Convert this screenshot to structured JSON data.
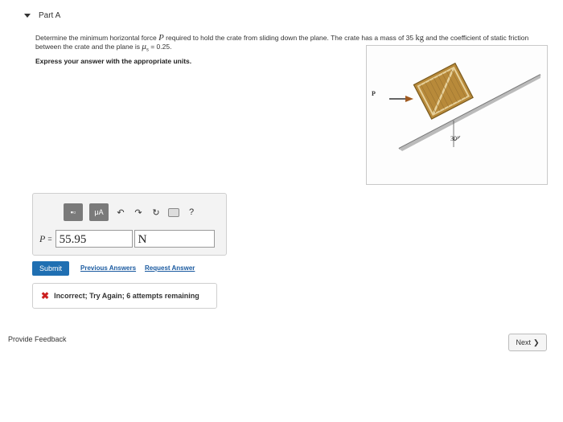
{
  "part": {
    "title": "Part A"
  },
  "problem": {
    "text_a": "Determine the minimum horizontal force ",
    "force_var": "P",
    "text_b": " required to hold the crate from sliding down the plane. The crate has a mass of 35 ",
    "mass_unit": "kg",
    "text_c": " and the coefficient of static friction between the crate and the plane is ",
    "mu": "μ",
    "mu_sub": "s",
    "text_d": " = 0.25.",
    "instruction": "Express your answer with the appropriate units."
  },
  "figure": {
    "force_label": "P",
    "angle_label": "30°"
  },
  "toolbar": {
    "templates_label": "▪▫",
    "units_label": "μA",
    "undo_symbol": "↶",
    "redo_symbol": "↷",
    "reset_symbol": "↻",
    "help_symbol": "?"
  },
  "answer": {
    "label": "P",
    "eq": "=",
    "value": "55.95",
    "unit": "N"
  },
  "actions": {
    "submit": "Submit",
    "previous": "Previous Answers",
    "request": "Request Answer"
  },
  "feedback": {
    "icon": "✖",
    "message": "Incorrect; Try Again; 6 attempts remaining"
  },
  "footer": {
    "provide_feedback": "Provide Feedback",
    "next": "Next",
    "next_icon": "❯"
  }
}
